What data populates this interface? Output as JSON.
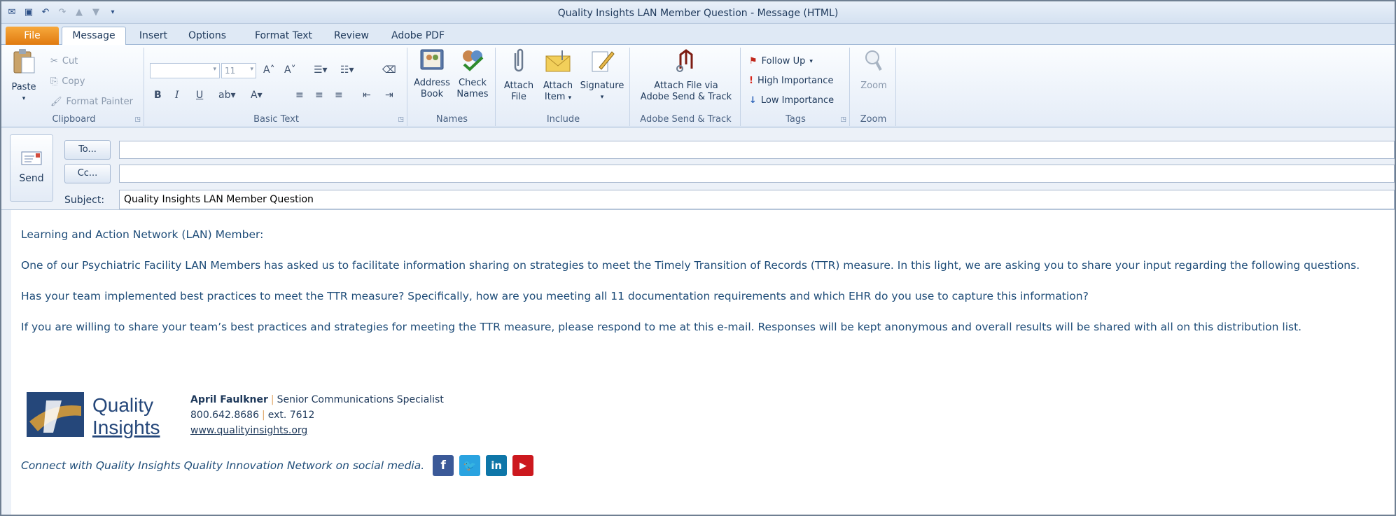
{
  "window": {
    "title": "Quality Insights LAN Member Question  -  Message (HTML)"
  },
  "tabs": [
    "File",
    "Message",
    "Insert",
    "Options",
    "Format Text",
    "Review",
    "Adobe PDF"
  ],
  "ribbon": {
    "clipboard": {
      "label": "Clipboard",
      "paste": "Paste",
      "cut": "Cut",
      "copy": "Copy",
      "format_painter": "Format Painter"
    },
    "basic_text": {
      "label": "Basic Text",
      "font_size": "11"
    },
    "names": {
      "label": "Names",
      "address_book_1": "Address",
      "address_book_2": "Book",
      "check_names_1": "Check",
      "check_names_2": "Names"
    },
    "include": {
      "label": "Include",
      "attach_file_1": "Attach",
      "attach_file_2": "File",
      "attach_item_1": "Attach",
      "attach_item_2": "Item",
      "signature": "Signature"
    },
    "adobe": {
      "label": "Adobe Send & Track",
      "attach_via_1": "Attach File via",
      "attach_via_2": "Adobe Send & Track"
    },
    "tags": {
      "label": "Tags",
      "follow_up": "Follow Up",
      "high": "High Importance",
      "low": "Low Importance"
    },
    "zoom": {
      "label": "Zoom",
      "zoom": "Zoom"
    }
  },
  "compose": {
    "send": "Send",
    "to": "To...",
    "cc": "Cc...",
    "subject_label": "Subject:",
    "subject_value": "Quality Insights LAN Member Question"
  },
  "body": {
    "greeting": "Learning and Action Network (LAN) Member:",
    "p1": "One of our Psychiatric Facility LAN Members has asked us to facilitate information sharing on strategies to meet the Timely Transition of Records (TTR) measure. In this light, we are asking you to share your input regarding the following questions.",
    "p2": "Has your team implemented best practices to meet the TTR measure? Specifically, how are you meeting all 11 documentation requirements and which EHR do you use to capture this information?",
    "p3": "If you are willing to share your team’s best practices and strategies for meeting the TTR measure, please respond to me at this e-mail. Responses will be kept anonymous and overall results will be shared with all on this distribution list."
  },
  "signature": {
    "logo_line1": "Quality",
    "logo_line2": "Insights",
    "name": "April Faulkner",
    "title": "Senior Communications Specialist",
    "phone": "800.642.8686",
    "ext": "ext. 7612",
    "website": "www.qualityinsights.org"
  },
  "social": {
    "text": "Connect with Quality Insights Quality Innovation Network on social media.",
    "icons": [
      "facebook-icon",
      "twitter-icon",
      "linkedin-icon",
      "youtube-icon"
    ]
  },
  "colors": {
    "file_tab": "#e07a10",
    "link_text": "#1f4d79",
    "logo_blue": "#25477a",
    "logo_gold": "#c4933f"
  }
}
